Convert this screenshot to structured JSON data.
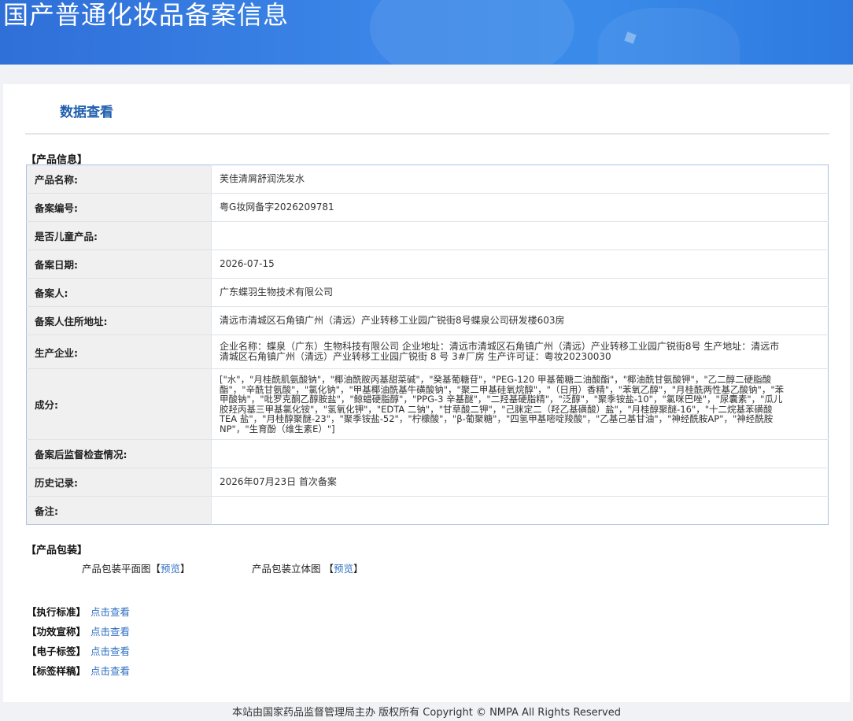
{
  "header": {
    "title": "国产普通化妆品备案信息"
  },
  "tab": {
    "label": "数据查看"
  },
  "product_section": {
    "title": "【产品信息】"
  },
  "rows": [
    {
      "label": "产品名称:",
      "value": "芙佳清屑舒润洗发水"
    },
    {
      "label": "备案编号:",
      "value": "粤G妆网备字2026209781"
    },
    {
      "label": "是否儿童产品:",
      "value": ""
    },
    {
      "label": "备案日期:",
      "value": "2026-07-15"
    },
    {
      "label": "备案人:",
      "value": "广东蝶羽生物技术有限公司"
    },
    {
      "label": "备案人住所地址:",
      "value": "清远市清城区石角镇广州（清远）产业转移工业园广锐街8号蝶泉公司研发楼603房"
    },
    {
      "label": "生产企业:",
      "value": "企业名称：蝶泉（广东）生物科技有限公司 企业地址：清远市清城区石角镇广州（清远）产业转移工业园广锐街8号 生产地址：清远市清城区石角镇广州（清远）产业转移工业园广锐街 8 号 3#厂房 生产许可证：粤妆20230030"
    },
    {
      "label": "成分:",
      "value": "[\"水\"，\"月桂酰肌氨酸钠\"，\"椰油酰胺丙基甜菜碱\"，\"癸基葡糖苷\"，\"PEG-120 甲基葡糖二油酸酯\"，\"椰油酰甘氨酸钾\"，\"乙二醇二硬脂酸酯\"，\"辛酰甘氨酸\"，\"氯化钠\"，\"甲基椰油酰基牛磺酸钠\"，\"聚二甲基硅氧烷醇\"，\"（日用）香精\"，\"苯氧乙醇\"，\"月桂酰两性基乙酸钠\"，\"苯甲酸钠\"，\"吡罗克酮乙醇胺盐\"，\"鲸蜡硬脂醇\"，\"PPG-3 辛基醚\"，\"二羟基硬脂精\"，\"泛醇\"，\"聚季铵盐-10\"，\"氯咪巴唑\"，\"尿囊素\"，\"瓜儿胶羟丙基三甲基氯化铵\"，\"氢氧化钾\"，\"EDTA 二钠\"，\"甘草酸二钾\"，\"己脒定二（羟乙基磺酸）盐\"，\"月桂醇聚醚-16\"，\"十二烷基苯磺酸 TEA 盐\"，\"月桂醇聚醚-23\"，\"聚季铵盐-52\"，\"柠檬酸\"，\"β-葡聚糖\"，\"四氢甲基嘧啶羧酸\"，\"乙基己基甘油\"，\"神经酰胺AP\"，\"神经酰胺 NP\"，\"生育酚（维生素E）\"]"
    },
    {
      "label": "备案后监督检查情况:",
      "value": ""
    },
    {
      "label": "历史记录:",
      "value": "2026年07月23日 首次备案"
    },
    {
      "label": "备注:",
      "value": ""
    }
  ],
  "packaging": {
    "title": "【产品包装】",
    "flat_label": "产品包装平面图",
    "solid_label": "产品包装立体图",
    "preview": "预览",
    "bracket_open": "【",
    "bracket_close": "】"
  },
  "links": [
    {
      "label": "【执行标准】",
      "action": "点击查看"
    },
    {
      "label": "【功效宣称】",
      "action": "点击查看"
    },
    {
      "label": "【电子标签】",
      "action": "点击查看"
    },
    {
      "label": "【标签样稿】",
      "action": "点击查看"
    }
  ],
  "footer": {
    "text": "本站由国家药品监督管理局主办 版权所有 Copyright © NMPA All Rights Reserved"
  }
}
